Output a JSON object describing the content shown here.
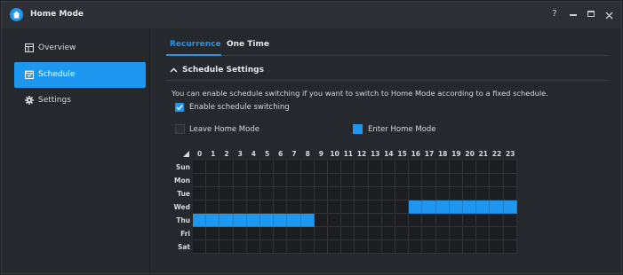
{
  "window": {
    "title": "Home Mode",
    "controls": {
      "help": "?"
    }
  },
  "sidebar": {
    "items": [
      {
        "label": "Overview",
        "icon": "overview-icon",
        "active": false
      },
      {
        "label": "Schedule",
        "icon": "calendar-icon",
        "active": true
      },
      {
        "label": "Settings",
        "icon": "gear-icon",
        "active": false
      }
    ]
  },
  "tabs": [
    {
      "label": "Recurrence",
      "active": true
    },
    {
      "label": "One Time",
      "active": false
    }
  ],
  "schedule_settings": {
    "title": "Schedule Settings",
    "description": "You can enable schedule switching if you want to switch to Home Mode according to a fixed schedule.",
    "enable_label": "Enable schedule switching",
    "enable_checked": true,
    "legend": {
      "leave": "Leave Home Mode",
      "enter": "Enter Home Mode"
    }
  },
  "grid": {
    "hours": [
      "0",
      "1",
      "2",
      "3",
      "4",
      "5",
      "6",
      "7",
      "8",
      "9",
      "10",
      "11",
      "12",
      "13",
      "14",
      "15",
      "16",
      "17",
      "18",
      "19",
      "20",
      "21",
      "22",
      "23"
    ],
    "days": [
      "Sun",
      "Mon",
      "Tue",
      "Wed",
      "Thu",
      "Fri",
      "Sat"
    ],
    "enter_home_hours": {
      "Wed": [
        16,
        17,
        18,
        19,
        20,
        21,
        22,
        23
      ],
      "Thu": [
        0,
        1,
        2,
        3,
        4,
        5,
        6,
        7,
        8
      ]
    }
  },
  "colors": {
    "accent": "#1e97f0",
    "background": "#25282c",
    "cell_empty": "#1b1d20"
  }
}
